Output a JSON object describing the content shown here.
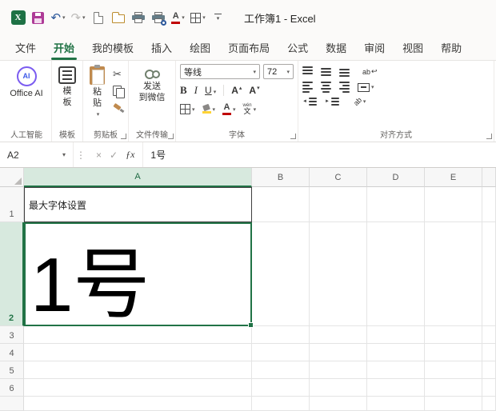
{
  "titlebar": {
    "title": "工作簿1 - Excel",
    "logo_letter": "X"
  },
  "tabs": [
    "文件",
    "开始",
    "我的模板",
    "插入",
    "绘图",
    "页面布局",
    "公式",
    "数据",
    "审阅",
    "视图",
    "帮助"
  ],
  "active_tab": "开始",
  "ribbon": {
    "ai": {
      "button_label": "Office AI",
      "group_label": "人工智能",
      "icon_text": "AI"
    },
    "template": {
      "button_label": "模板",
      "group_label": "模板"
    },
    "clipboard": {
      "paste_label": "粘贴",
      "group_label": "剪贴板"
    },
    "transfer": {
      "button_label": "发送\n到微信",
      "group_label": "文件传输"
    },
    "font": {
      "font_name": "等线",
      "font_size": "72",
      "bold": "B",
      "italic": "I",
      "underline": "U",
      "grow_shrink_letter": "A",
      "font_color_letter": "A",
      "phonetic_top": "wén",
      "phonetic_bottom": "文",
      "group_label": "字体"
    },
    "align": {
      "wrap_label": "ab",
      "orient_label": "ab",
      "group_label": "对齐方式"
    }
  },
  "formula_bar": {
    "name_box": "A2",
    "formula": "1号"
  },
  "grid": {
    "column_headers": [
      "A",
      "B",
      "C",
      "D",
      "E"
    ],
    "row_headers": [
      "1",
      "2",
      "3",
      "4",
      "5",
      "6"
    ],
    "cells": {
      "A1": "最大字体设置",
      "A2": "1号"
    },
    "active_cell": "A2"
  },
  "glyphs": {
    "dropdown": "▾",
    "undo": "↶",
    "redo": "↷",
    "scissors": "✂",
    "check": "✓",
    "cancel": "×",
    "fx": "ƒx",
    "grip_dots": "⋮",
    "wrap_return": "↩",
    "indent_dec": "◄",
    "indent_inc": "►",
    "caret_up": "▴",
    "caret_down": "▾"
  },
  "colors": {
    "excel_green": "#217346",
    "header_selection_fill": "#d7e9de",
    "font_color_red": "#c00000",
    "fill_color_yellow": "#ffd335",
    "save_icon": "#ae3b97"
  }
}
